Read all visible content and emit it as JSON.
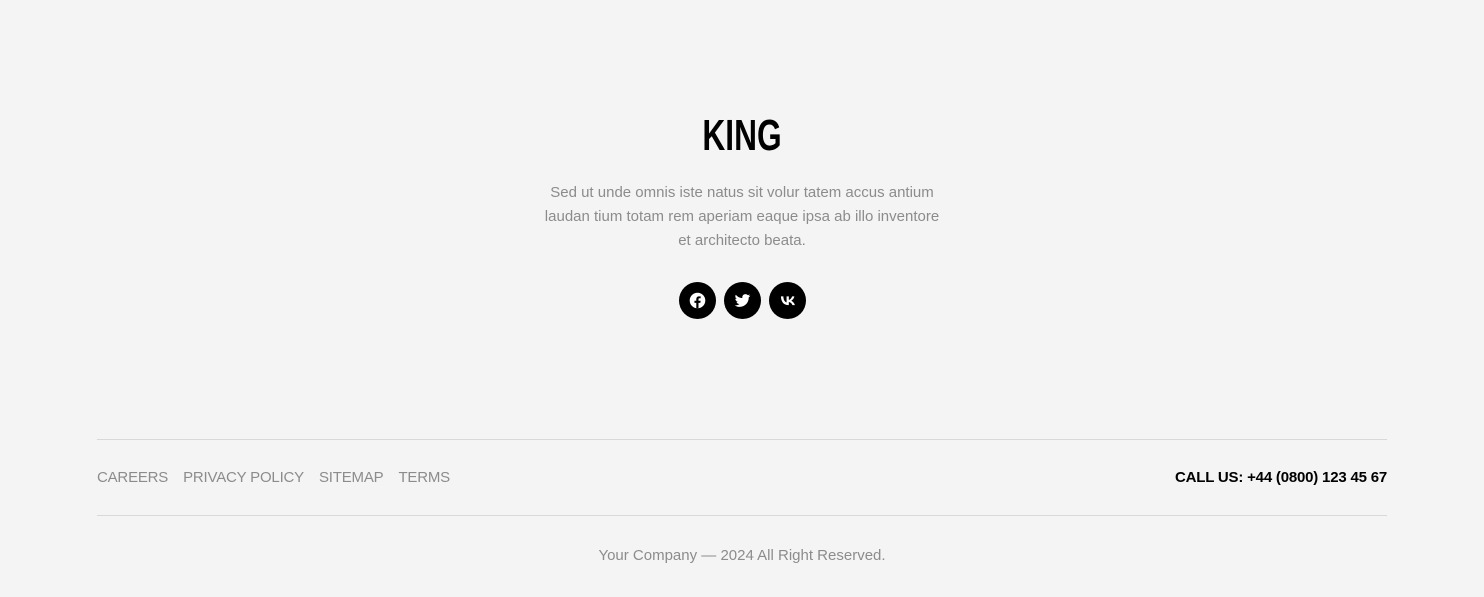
{
  "brand": {
    "logo_text": "KING",
    "tagline": "Sed ut unde omnis iste natus sit volur tatem accus antium laudan tium totam rem aperiam eaque ipsa ab illo inventore et architecto beata."
  },
  "social": [
    {
      "name": "facebook",
      "icon": "facebook-icon"
    },
    {
      "name": "twitter",
      "icon": "twitter-icon"
    },
    {
      "name": "vk",
      "icon": "vk-icon"
    }
  ],
  "footer": {
    "nav": [
      {
        "label": "CAREERS"
      },
      {
        "label": "PRIVACY POLICY"
      },
      {
        "label": "SITEMAP"
      },
      {
        "label": "TERMS"
      }
    ],
    "call_us": "CALL US: +44 (0800) 123 45 67",
    "copyright": "Your Company — 2024 All Right Reserved."
  },
  "colors": {
    "background": "#f4f4f4",
    "text_muted": "#8c8c8c",
    "text_strong": "#000000",
    "divider": "#d8d8d8"
  }
}
